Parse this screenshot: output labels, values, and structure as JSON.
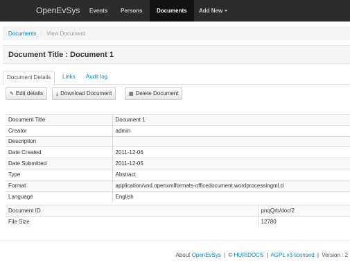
{
  "navbar": {
    "brand": "OpenEvSys",
    "items": [
      {
        "label": "Events"
      },
      {
        "label": "Persons"
      },
      {
        "label": "Documents"
      },
      {
        "label": "Add New"
      }
    ]
  },
  "breadcrumb": {
    "root": "Documents",
    "separator": "/",
    "current": "View Document"
  },
  "page_title": "Document Title : Document 1",
  "tabs": [
    {
      "label": "Document Details"
    },
    {
      "label": "Links"
    },
    {
      "label": "Audit log"
    }
  ],
  "toolbar": {
    "edit_label": "Edit details",
    "download_label": "Download Document",
    "delete_label": "Delete Document"
  },
  "details": [
    {
      "label": "Document Title",
      "value": "Document 1"
    },
    {
      "label": "Creator",
      "value": "admin"
    },
    {
      "label": "Description",
      "value": ""
    },
    {
      "label": "Date Created",
      "value": "2011-12-06"
    },
    {
      "label": "Date Submitted",
      "value": "2011-12-05"
    },
    {
      "label": "Type",
      "value": "Abstract"
    },
    {
      "label": "Format",
      "value": "application/vnd.openxmlformats-officedocument.wordprocessingml.d"
    },
    {
      "label": "Language",
      "value": "English"
    }
  ],
  "file_info": [
    {
      "label": "Document ID",
      "value": "pnqQrb/doc/2"
    },
    {
      "label": "File Size",
      "value": "12780"
    }
  ],
  "footer": {
    "about": "About",
    "app_link": "OpenEvSys",
    "sep1": "|",
    "copyright": "©",
    "org_link": "HURIDOCS",
    "sep2": "|",
    "license_link": "AGPL v3 licensed",
    "sep3": "|",
    "version": "Version : 2"
  },
  "colors": {
    "navbar_bg": "#2c2c2c",
    "active_nav_bg": "#111111",
    "link": "#0088cc"
  }
}
